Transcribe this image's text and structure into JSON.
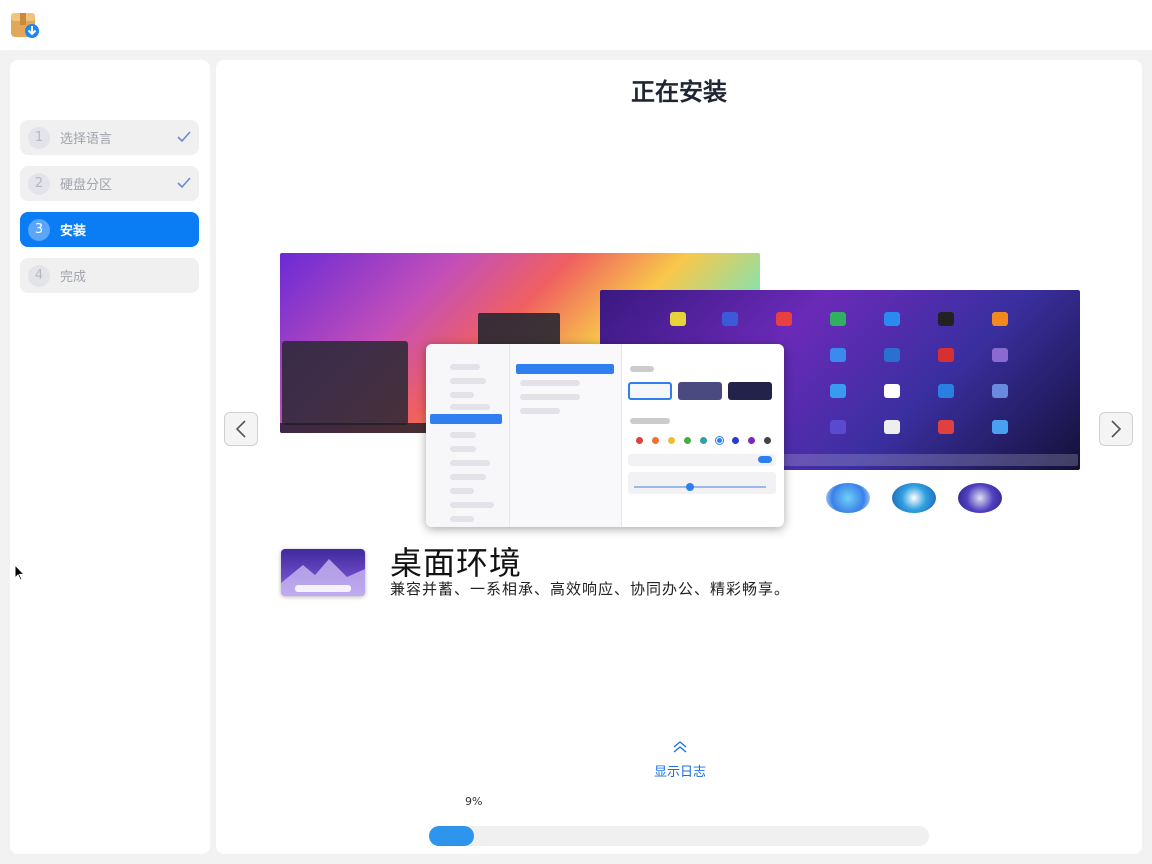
{
  "app": {
    "icon": "installer-package-icon"
  },
  "steps": [
    {
      "num": "1",
      "label": "选择语言",
      "state": "done"
    },
    {
      "num": "2",
      "label": "硬盘分区",
      "state": "done"
    },
    {
      "num": "3",
      "label": "安装",
      "state": "active"
    },
    {
      "num": "4",
      "label": "完成",
      "state": "pending"
    }
  ],
  "main": {
    "title": "正在安装",
    "slide": {
      "feature_title": "桌面环境",
      "feature_desc": "兼容并蓄、一系相承、高效响应、协同办公、精彩畅享。"
    },
    "log_toggle": "显示日志",
    "progress": {
      "percent_text": "9%",
      "value": 0.09
    }
  },
  "colors": {
    "accent": "#0a7cf4",
    "progress": "#2e95ec",
    "check": "#6b8cc8"
  }
}
